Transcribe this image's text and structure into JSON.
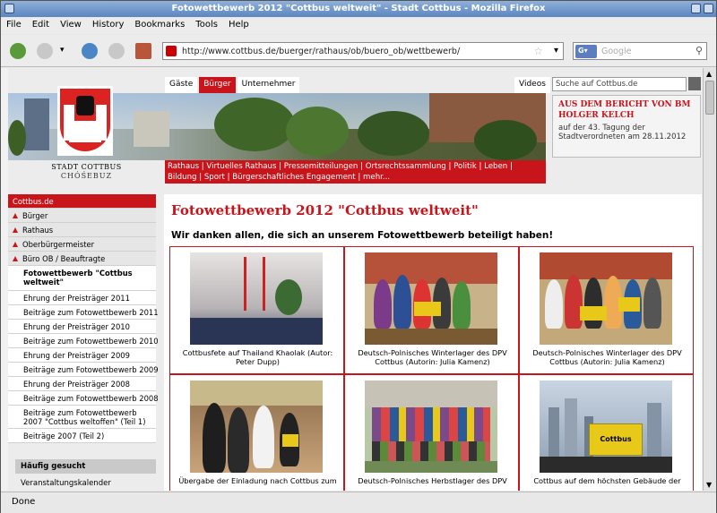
{
  "window": {
    "title": "Fotowettbewerb 2012 \"Cottbus weltweit\" - Stadt Cottbus - Mozilla Firefox"
  },
  "menu": [
    "File",
    "Edit",
    "View",
    "History",
    "Bookmarks",
    "Tools",
    "Help"
  ],
  "url": "http://www.cottbus.de/buerger/rathaus/ob/buero_ob/wettbewerb/",
  "search_placeholder": "Google",
  "status": "Done",
  "site": {
    "topnav": [
      "Gäste",
      "Bürger",
      "Unternehmer"
    ],
    "active_topnav": "Bürger",
    "videos": "Videos",
    "logo_line1": "STADT COTTBUS",
    "logo_line2": "CHÓŚEBUZ",
    "rednav": "Rathaus | Virtuelles Rathaus | Pressemitteilungen | Ortsrechtssammlung | Politik | Leben | Bildung | Sport | Bürgerschaftliches Engagement | mehr...",
    "search_text": "Suche auf Cottbus.de",
    "news_heading": "AUS DEM BERICHT VON BM HOLGER KELCH",
    "news_sub": "auf der 43. Tagung der Stadtverordneten am 28.11.2012"
  },
  "sidebar": {
    "home": "Cottbus.de",
    "top_items": [
      "Bürger",
      "Rathaus",
      "Oberbürgermeister",
      "Büro OB / Beauftragte"
    ],
    "current": "Fotowettbewerb \"Cottbus weltweit\"",
    "sub_items": [
      "Ehrung der Preisträger 2011",
      "Beiträge zum Fotowettbewerb 2011",
      "Ehrung der Preisträger 2010",
      "Beiträge zum Fotowettbewerb 2010",
      "Ehrung der Preisträger 2009",
      "Beiträge zum Fotowettbewerb 2009",
      "Ehrung der Preisträger 2008",
      "Beiträge zum Fotowettbewerb 2008"
    ],
    "tall_item": "Beiträge zum Fotowettbewerb 2007 \"Cottbus weltoffen\" (Teil 1)",
    "last_item": "Beiträge 2007 (Teil 2)",
    "haeufig": "Häufig gesucht",
    "haeufig_item": "Veranstaltungskalender"
  },
  "main": {
    "title": "Fotowettbewerb 2012 \"Cottbus weltweit\"",
    "heading": "Wir danken allen, die sich an unserem Fotowettbewerb beteiligt haben!",
    "captions": [
      "Cottbusfete auf Thailand Khaolak (Autor: Peter Dupp)",
      "Deutsch-Polnisches Winterlager des DPV Cottbus (Autorin: Julia Kamenz)",
      "Deutsch-Polnisches Winterlager des DPV Cottbus (Autorin: Julia Kamenz)",
      "Übergabe der Einladung nach Cottbus zum",
      "Deutsch-Polnisches Herbstlager des DPV",
      "Cottbus auf dem höchsten Gebäude der"
    ],
    "sign_text": "Cottbus"
  },
  "colors": {
    "brand_red": "#c8141b"
  }
}
